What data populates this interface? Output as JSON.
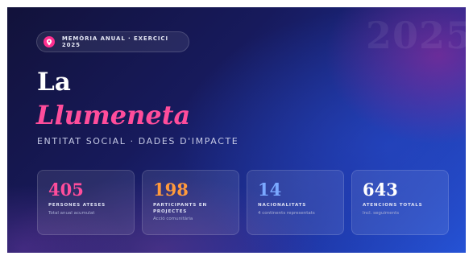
{
  "watermark": "2025",
  "badge": {
    "icon": "location-pin-icon",
    "text": "MEMÒRIA ANUAL · EXERCICI 2025"
  },
  "hero": {
    "title_line1": "La",
    "title_line2": "Llumeneta",
    "subtitle": "ENTITAT SOCIAL · DADES D'IMPACTE"
  },
  "stats": [
    {
      "value": "405",
      "label": "PERSONES ATESES",
      "note": "Total anual acumulat",
      "color": "#ff4d9b"
    },
    {
      "value": "198",
      "label": "PARTICIPANTS EN PROJECTES",
      "note": "Acció comunitària",
      "color": "#ff9a3c"
    },
    {
      "value": "14",
      "label": "NACIONALITATS",
      "note": "4 continents representats",
      "color": "#7aa8ff"
    },
    {
      "value": "643",
      "label": "ATENCIONS TOTALS",
      "note": "Incl. seguiments",
      "color": "#ffffff"
    }
  ]
}
